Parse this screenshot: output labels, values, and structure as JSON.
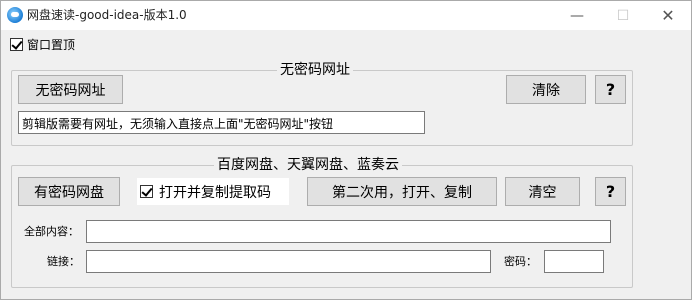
{
  "window": {
    "title": "网盘速读-good-idea-版本1.0",
    "minimize": "—",
    "maximize": "☐",
    "close": "✕"
  },
  "topmost": {
    "label": "窗口置顶",
    "checked": true
  },
  "group1": {
    "title": "无密码网址",
    "no_password_button": "无密码网址",
    "clear_button": "清除",
    "help_button": "?",
    "url_value": "剪辑版需要有网址，无须输入直接点上面\"无密码网址\"按钮"
  },
  "group2": {
    "title": "百度网盘、天翼网盘、蓝奏云",
    "with_password_button": "有密码网盘",
    "copy_checkbox_label": "打开并复制提取码",
    "copy_checked": true,
    "second_use_button": "第二次用，打开、复制",
    "clear_button": "清空",
    "help_button": "?",
    "all_content_label": "全部内容：",
    "all_content_value": "",
    "link_label": "链接：",
    "link_value": "",
    "password_label": "密码：",
    "password_value": ""
  }
}
